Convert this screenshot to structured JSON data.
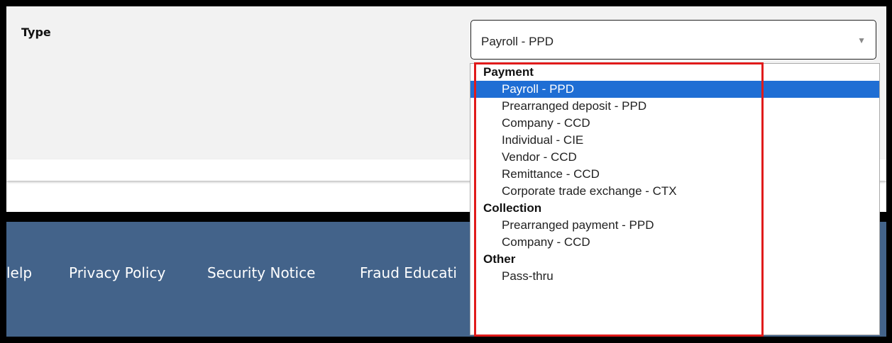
{
  "form": {
    "type_label": "Type",
    "select": {
      "value": "Payroll - PPD",
      "arrow_icon": "▼"
    }
  },
  "dropdown": {
    "selected": "Payroll - PPD",
    "groups": [
      {
        "label": "Payment",
        "options": [
          "Payroll - PPD",
          "Prearranged deposit - PPD",
          "Company - CCD",
          "Individual - CIE",
          "Vendor - CCD",
          "Remittance - CCD",
          "Corporate trade exchange - CTX"
        ]
      },
      {
        "label": "Collection",
        "options": [
          "Prearranged payment - PPD",
          "Company - CCD"
        ]
      },
      {
        "label": "Other",
        "options": [
          "Pass-thru"
        ]
      }
    ]
  },
  "footer": {
    "links": [
      "lelp",
      "Privacy Policy",
      "Security Notice",
      "Fraud Educati"
    ]
  },
  "colors": {
    "footer_bg": "#43638a",
    "selected_bg": "#1f6ed4",
    "highlight": "#e01b1b"
  }
}
